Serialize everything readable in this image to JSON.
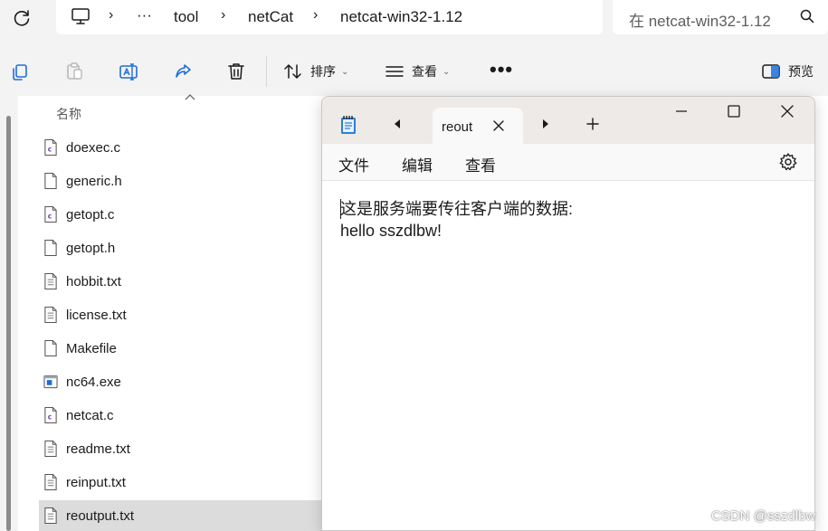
{
  "address_bar": {
    "crumbs": [
      "tool",
      "netCat",
      "netcat-win32-1.12"
    ],
    "ellipsis": "···",
    "search_placeholder": "在 netcat-win32-1.12"
  },
  "command_bar": {
    "sort_label": "排序",
    "view_label": "查看",
    "more_label": "•••",
    "preview_label": "预览"
  },
  "file_list": {
    "column_name": "名称",
    "files": [
      {
        "name": "doexec.c",
        "icon": "c-source-file-icon"
      },
      {
        "name": "generic.h",
        "icon": "blank-file-icon"
      },
      {
        "name": "getopt.c",
        "icon": "c-source-file-icon"
      },
      {
        "name": "getopt.h",
        "icon": "blank-file-icon"
      },
      {
        "name": "hobbit.txt",
        "icon": "text-file-icon"
      },
      {
        "name": "license.txt",
        "icon": "text-file-icon"
      },
      {
        "name": "Makefile",
        "icon": "blank-file-icon"
      },
      {
        "name": "nc64.exe",
        "icon": "exe-file-icon"
      },
      {
        "name": "netcat.c",
        "icon": "c-source-file-icon"
      },
      {
        "name": "readme.txt",
        "icon": "text-file-icon"
      },
      {
        "name": "reinput.txt",
        "icon": "text-file-icon"
      },
      {
        "name": "reoutput.txt",
        "icon": "text-file-icon",
        "selected": true
      }
    ]
  },
  "notepad": {
    "tab_title": "reout",
    "menu": [
      "文件",
      "编辑",
      "查看"
    ],
    "content_line1": "这是服务端要传往客户端的数据:",
    "content_line2": "hello sszdlbw!"
  },
  "watermark": "CSDN @sszdlbw",
  "colors": {
    "selected_row": "#dcdcdc",
    "notepad_title_bg": "#eeeae7",
    "accent_blue": "#1e6ed8"
  }
}
